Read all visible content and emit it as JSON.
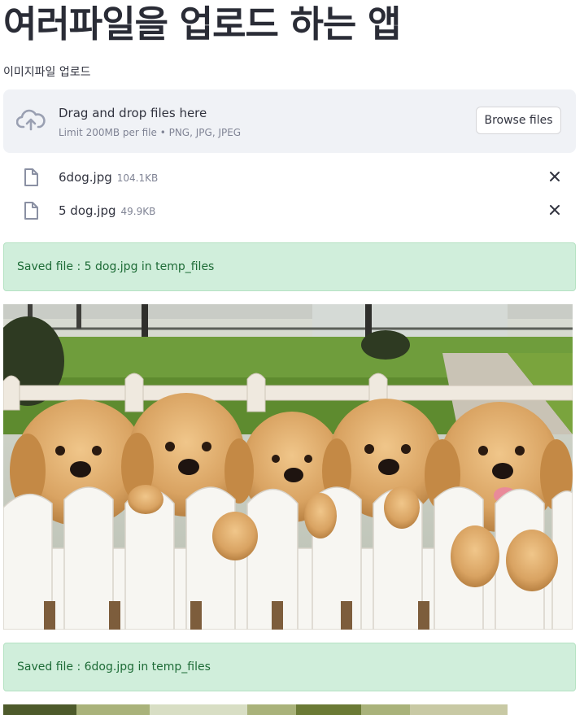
{
  "page": {
    "title": "여러파일을 업로드 하는 앱"
  },
  "uploader": {
    "label": "이미지파일 업로드",
    "drag_text": "Drag and drop files here",
    "limit_text": "Limit 200MB per file • PNG, JPG, JPEG",
    "browse_label": "Browse files",
    "files": [
      {
        "name": "6dog.jpg",
        "size": "104.1KB"
      },
      {
        "name": "5 dog.jpg",
        "size": "49.9KB"
      }
    ]
  },
  "alerts": [
    {
      "text": "Saved file : 5 dog.jpg in temp_files"
    },
    {
      "text": "Saved file : 6dog.jpg in temp_files"
    }
  ],
  "images": [
    {
      "icon": "golden-retriever-puppies-photo"
    },
    {
      "icon": "garden-photo-partial"
    }
  ],
  "colors": {
    "dropzone_bg": "#f0f2f6",
    "success_bg": "#d0eedb",
    "success_text": "#1d6b36"
  }
}
